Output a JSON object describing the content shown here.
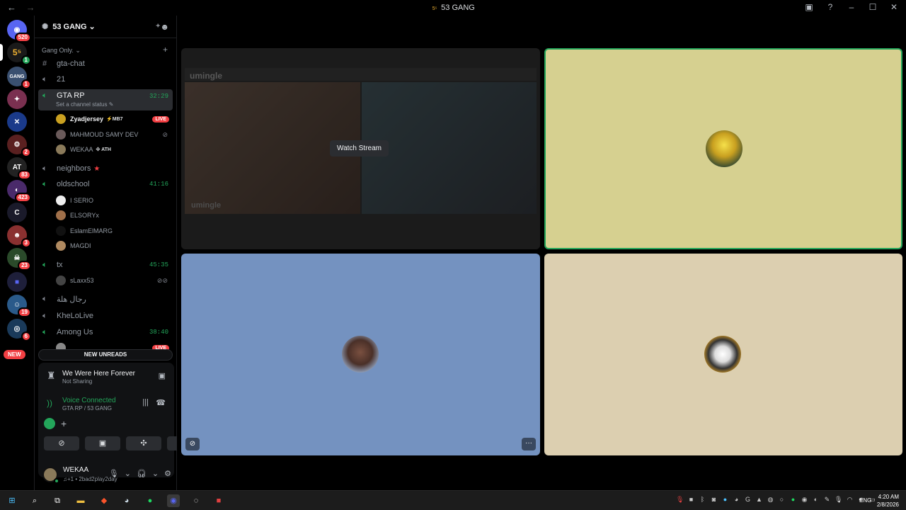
{
  "window": {
    "title": "53 GANG",
    "back": "←",
    "forward": "→"
  },
  "rail": {
    "dm_badge": "520",
    "server_53_badge": "1",
    "badges": [
      "1",
      "2",
      "83",
      "423",
      "3",
      "23",
      "19",
      "6"
    ],
    "new_label": "NEW"
  },
  "server": {
    "name": "53 GANG",
    "category": "Gang Only.",
    "channels": [
      {
        "name": "gta-chat"
      },
      {
        "name": "21"
      },
      {
        "name": "GTA RP",
        "time": "32:29",
        "status": "Set a channel status"
      },
      {
        "name": "neighbors"
      },
      {
        "name": "oldschool",
        "time": "41:16"
      },
      {
        "name": "tx",
        "time": "45:35"
      },
      {
        "name": "رجال هلة"
      },
      {
        "name": "KheLoLive"
      },
      {
        "name": "Among Us",
        "time": "38:40"
      }
    ],
    "gta_members": [
      {
        "name": "Zyadjersey",
        "tag": "⚡MB7",
        "live": "LIVE"
      },
      {
        "name": "MAHMOUD SAMY DEV"
      },
      {
        "name": "WEKAA",
        "tag": "✣ ATH"
      }
    ],
    "oldschool_members": [
      "I SERIO",
      "ELSORYx",
      "EslamElMARG",
      "MAGDI"
    ],
    "tx_members": [
      "sLaxx53"
    ],
    "among_live": "LIVE",
    "new_unreads": "NEW UNREADS"
  },
  "activity": {
    "title": "We Were Here Forever",
    "subtitle": "Not Sharing"
  },
  "voice": {
    "title": "Voice Connected",
    "subtitle": "GTA RP / 53 GANG"
  },
  "user": {
    "name": "WEKAA",
    "status": "♫+1 • 2bad2play2day"
  },
  "stage": {
    "watch_label": "Watch Stream",
    "stream_logo": "umingle",
    "more_label": "···"
  },
  "taskbar": {
    "lang": "ENG",
    "time": "4:20 AM",
    "date": "2/8/2026"
  },
  "colors": {
    "accent_green": "#23a55a",
    "live_red": "#f23f43",
    "tile2": "#d6d090",
    "tile3": "#7492c0",
    "tile4": "#dccfb0"
  }
}
